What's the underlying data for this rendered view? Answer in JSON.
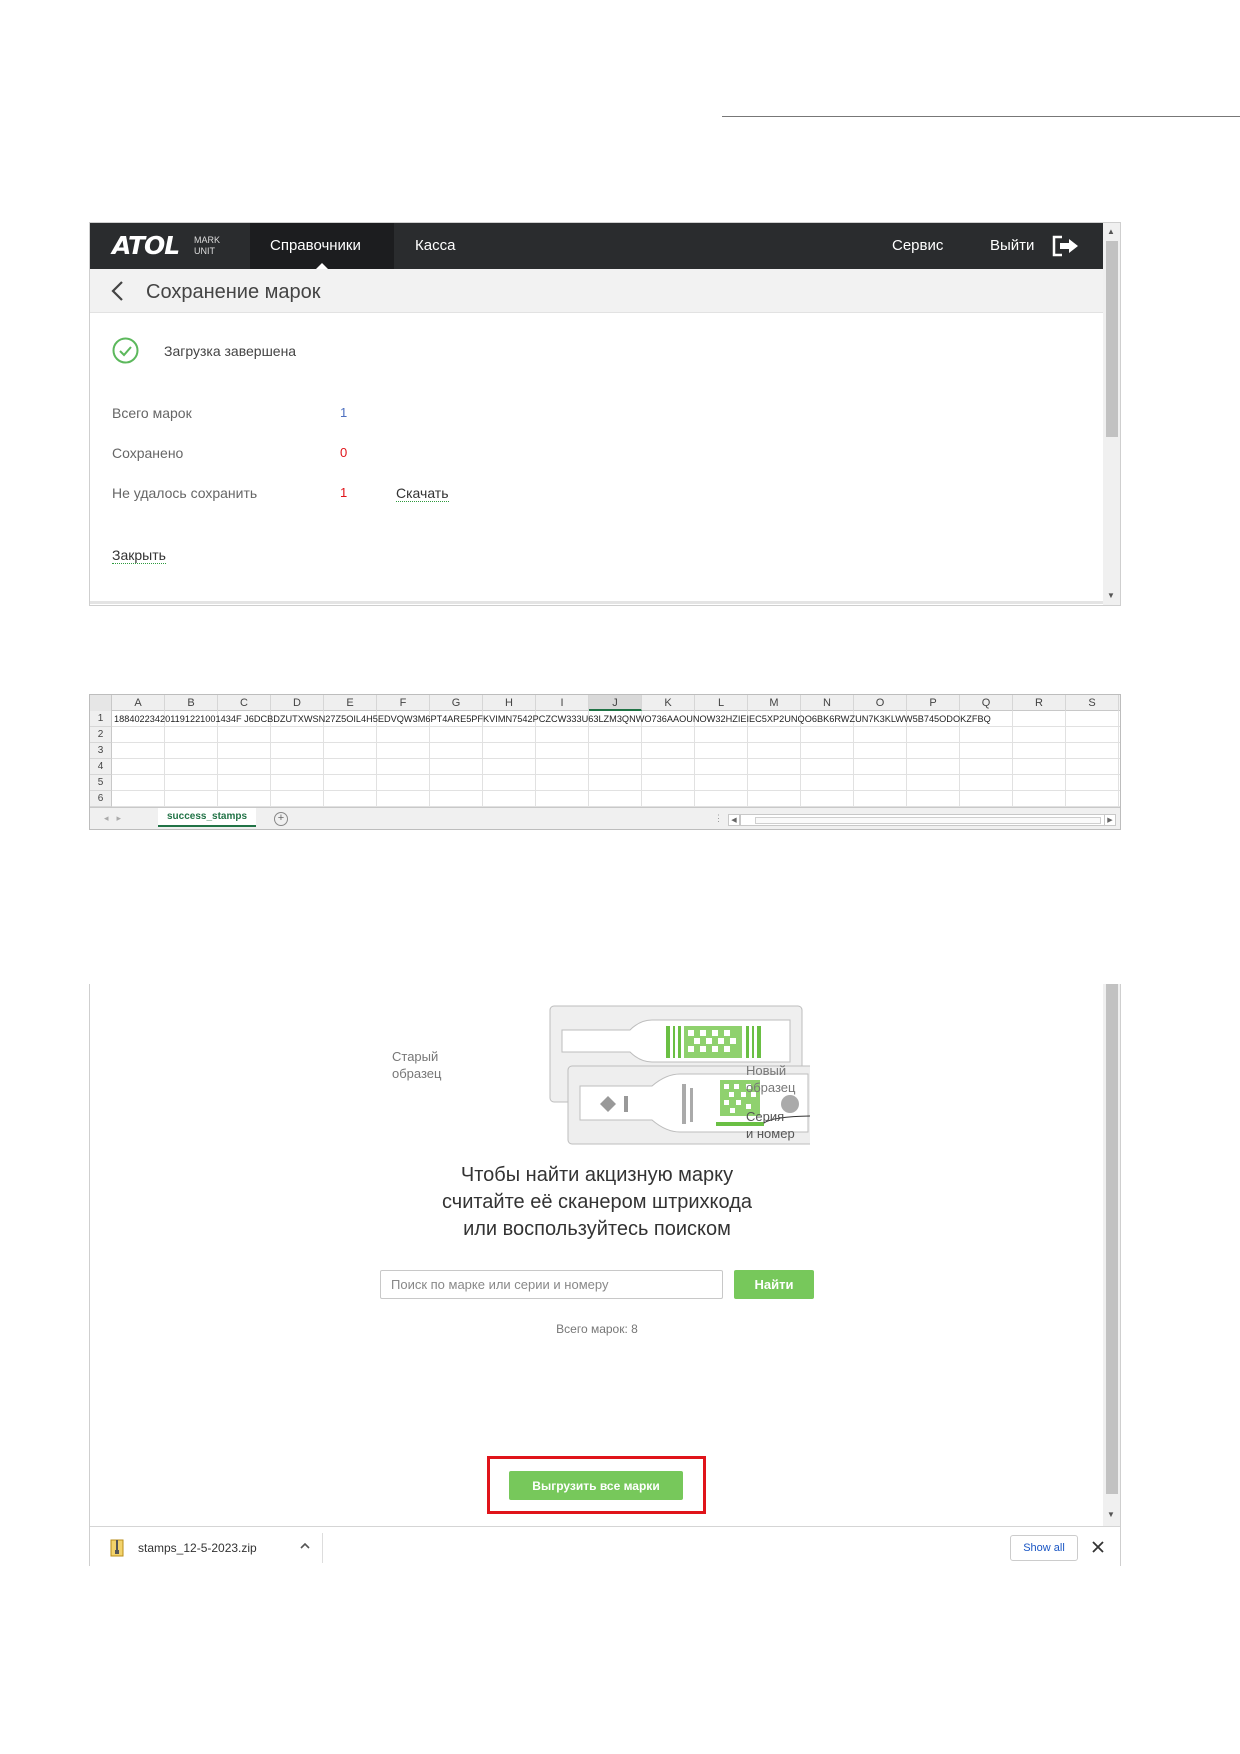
{
  "screen1": {
    "logo_text": "ATOL",
    "logo_sub1": "MARK",
    "logo_sub2": "UNIT",
    "nav": {
      "directories": "Справочники",
      "cashier": "Касса",
      "service": "Сервис",
      "logout": "Выйти"
    },
    "page_title": "Сохранение марок",
    "status": "Загрузка завершена",
    "rows": [
      {
        "label": "Всего марок",
        "value": "1"
      },
      {
        "label": "Сохранено",
        "value": "0"
      },
      {
        "label": "Не удалось сохранить",
        "value": "1"
      }
    ],
    "download_link": "Скачать",
    "close_link": "Закрыть",
    "colors": {
      "navbar": "#2a2c2e",
      "accent": "#5cb85c",
      "error": "#e0141a"
    }
  },
  "screen2": {
    "columns": [
      "A",
      "B",
      "C",
      "D",
      "E",
      "F",
      "G",
      "H",
      "I",
      "J",
      "K",
      "L",
      "M",
      "N",
      "O",
      "P",
      "Q",
      "R",
      "S"
    ],
    "selected_column": "J",
    "rows": [
      "1",
      "2",
      "3",
      "4",
      "5",
      "6"
    ],
    "cell_a1": "188402234201191221001434F J6DCBDZUTXWSN27Z5OIL4H5EDVQW3M6PT4ARE5PFKVIMN7542PCZCW333U63LZM3QNWO736AAOUNOW32HZIEIEC5XP2UNQO6BK6RWZUN7K3KLWW5B745ODOKZFBQ",
    "sheet_tab": "success_stamps",
    "add_sheet": "+"
  },
  "screen3": {
    "old_sample": [
      "Старый",
      "образец"
    ],
    "new_sample": [
      "Новый",
      "образец"
    ],
    "series_label": [
      "Серия",
      "и номер"
    ],
    "headline": [
      "Чтобы найти акцизную марку",
      "считайте её сканером штрихкода",
      "или воспользуйтесь поиском"
    ],
    "search_placeholder": "Поиск по марке или серии и номеру",
    "search_value": "",
    "find_button": "Найти",
    "total": "Всего марок: 8",
    "export_button": "Выгрузить все марки",
    "download_file": "stamps_12-5-2023.zip",
    "show_all": "Show all",
    "colors": {
      "button": "#77c85b",
      "highlight": "#e0141a",
      "illustration": "#6abf44"
    }
  }
}
